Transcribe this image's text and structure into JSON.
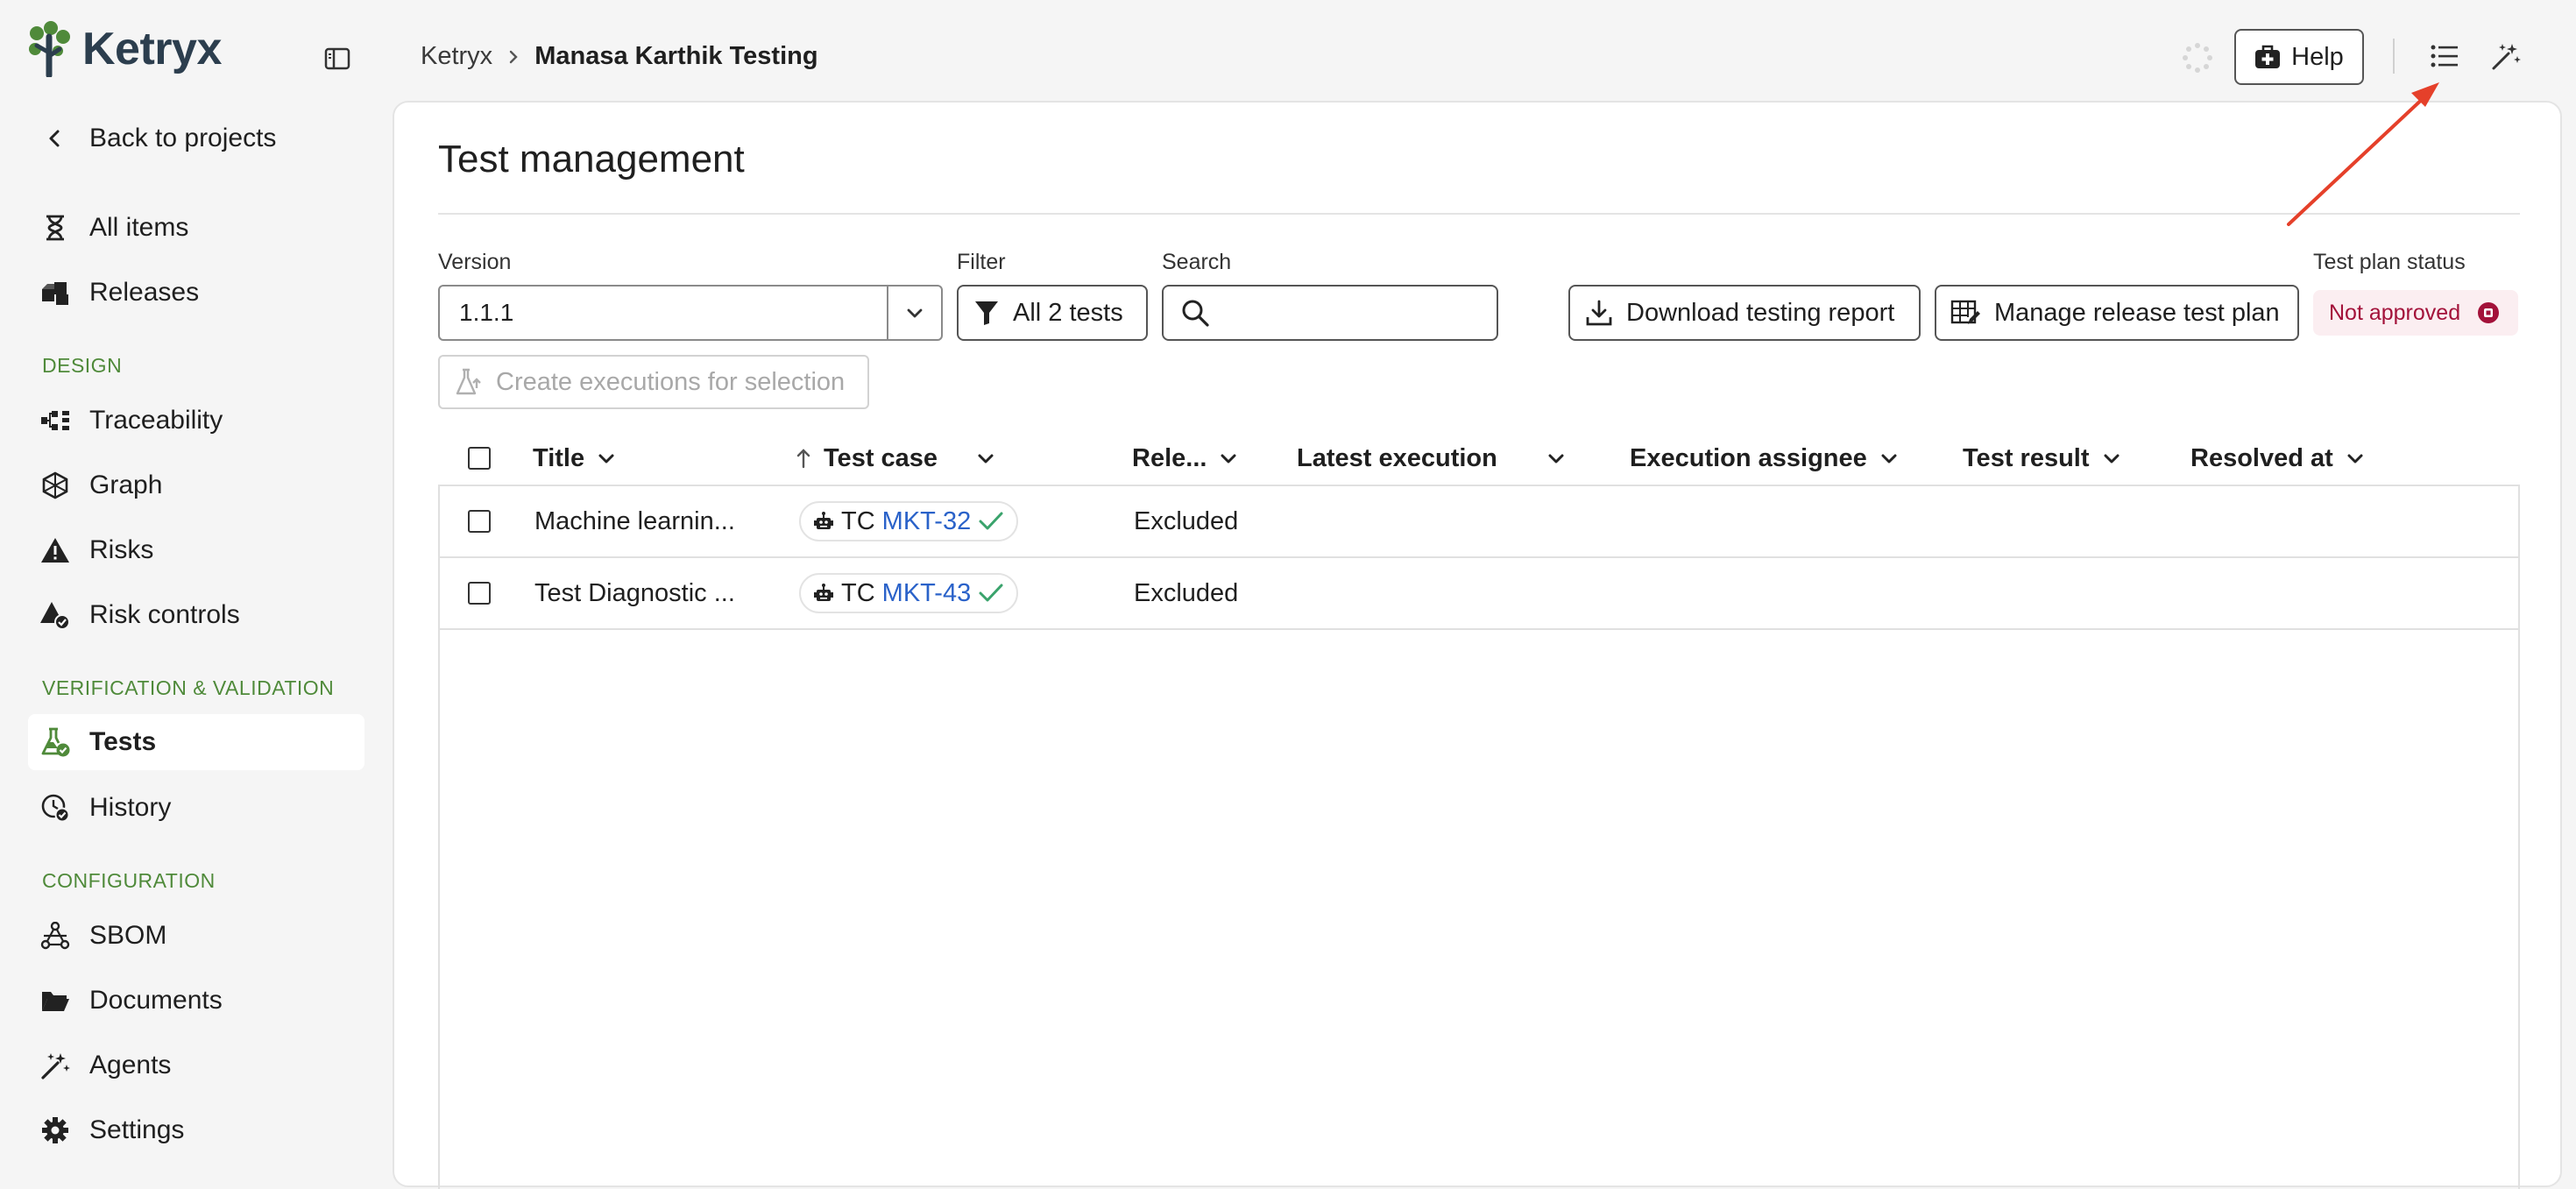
{
  "app": {
    "name": "Ketryx"
  },
  "sidebar": {
    "back_label": "Back to projects",
    "items": [
      {
        "label": "All items"
      },
      {
        "label": "Releases"
      },
      {
        "label": "Traceability"
      },
      {
        "label": "Graph"
      },
      {
        "label": "Risks"
      },
      {
        "label": "Risk controls"
      },
      {
        "label": "Tests"
      },
      {
        "label": "History"
      },
      {
        "label": "SBOM"
      },
      {
        "label": "Documents"
      },
      {
        "label": "Agents"
      },
      {
        "label": "Settings"
      }
    ],
    "sections": {
      "design": "DESIGN",
      "vv": "VERIFICATION & VALIDATION",
      "config": "CONFIGURATION"
    },
    "active_item": "Tests"
  },
  "header": {
    "breadcrumb_root": "Ketryx",
    "breadcrumb_current": "Manasa Karthik Testing",
    "help_label": "Help"
  },
  "page": {
    "title": "Test management",
    "version_label": "Version",
    "version_value": "1.1.1",
    "filter_label": "Filter",
    "filter_value": "All 2 tests",
    "search_label": "Search",
    "search_placeholder": "",
    "download_label": "Download testing report",
    "manage_label": "Manage release test plan",
    "status_label": "Test plan status",
    "status_value": "Not approved",
    "create_label": "Create executions for selection"
  },
  "table": {
    "columns": [
      "Title",
      "Test case",
      "Rele...",
      "Latest execution",
      "Execution assignee",
      "Test result",
      "Resolved at"
    ],
    "rows": [
      {
        "title": "Machine learnin...",
        "tc_prefix": "TC",
        "tc_id": "MKT-32",
        "release": "Excluded",
        "latest_execution": "",
        "assignee": "",
        "result": "",
        "resolved_at": ""
      },
      {
        "title": "Test Diagnostic ...",
        "tc_prefix": "TC",
        "tc_id": "MKT-43",
        "release": "Excluded",
        "latest_execution": "",
        "assignee": "",
        "result": "",
        "resolved_at": ""
      }
    ]
  },
  "colors": {
    "accent_green": "#4f8a3a",
    "link_blue": "#2a62c9",
    "status_red": "#a3123a",
    "arrow_red": "#e5402a"
  }
}
